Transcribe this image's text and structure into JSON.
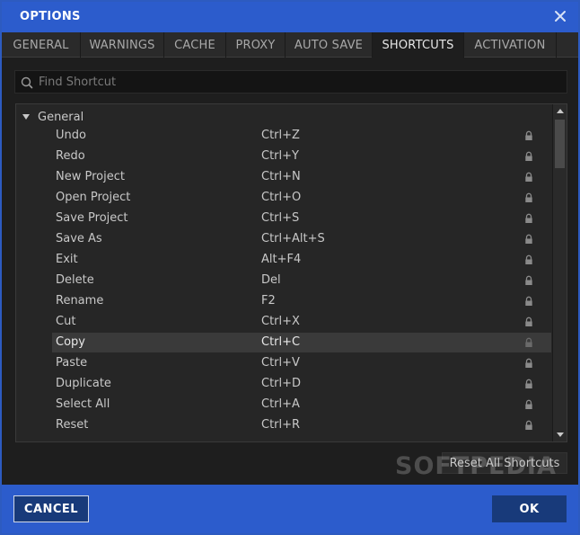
{
  "window": {
    "title": "OPTIONS"
  },
  "tabs": [
    {
      "label": "GENERAL"
    },
    {
      "label": "WARNINGS"
    },
    {
      "label": "CACHE"
    },
    {
      "label": "PROXY"
    },
    {
      "label": "AUTO SAVE"
    },
    {
      "label": "SHORTCUTS"
    },
    {
      "label": "ACTIVATION"
    }
  ],
  "active_tab": "SHORTCUTS",
  "search": {
    "placeholder": "Find Shortcut",
    "value": ""
  },
  "group": {
    "label": "General",
    "expanded": true
  },
  "shortcuts": [
    {
      "name": "Undo",
      "keys": "Ctrl+Z"
    },
    {
      "name": "Redo",
      "keys": "Ctrl+Y"
    },
    {
      "name": "New Project",
      "keys": "Ctrl+N"
    },
    {
      "name": "Open Project",
      "keys": "Ctrl+O"
    },
    {
      "name": "Save Project",
      "keys": "Ctrl+S"
    },
    {
      "name": "Save As",
      "keys": "Ctrl+Alt+S"
    },
    {
      "name": "Exit",
      "keys": "Alt+F4"
    },
    {
      "name": "Delete",
      "keys": "Del"
    },
    {
      "name": "Rename",
      "keys": "F2"
    },
    {
      "name": "Cut",
      "keys": "Ctrl+X"
    },
    {
      "name": "Copy",
      "keys": "Ctrl+C"
    },
    {
      "name": "Paste",
      "keys": "Ctrl+V"
    },
    {
      "name": "Duplicate",
      "keys": "Ctrl+D"
    },
    {
      "name": "Select All",
      "keys": "Ctrl+A"
    },
    {
      "name": "Reset",
      "keys": "Ctrl+R"
    }
  ],
  "selected_shortcut": "Copy",
  "reset_label": "Reset All Shortcuts",
  "watermark": "SOFTPEDIA",
  "footer": {
    "cancel_label": "CANCEL",
    "ok_label": "OK"
  },
  "colors": {
    "accent": "#2c5ccc",
    "button": "#183a7a",
    "background": "#1e1e1e",
    "selected_row": "#3a3a3a"
  }
}
